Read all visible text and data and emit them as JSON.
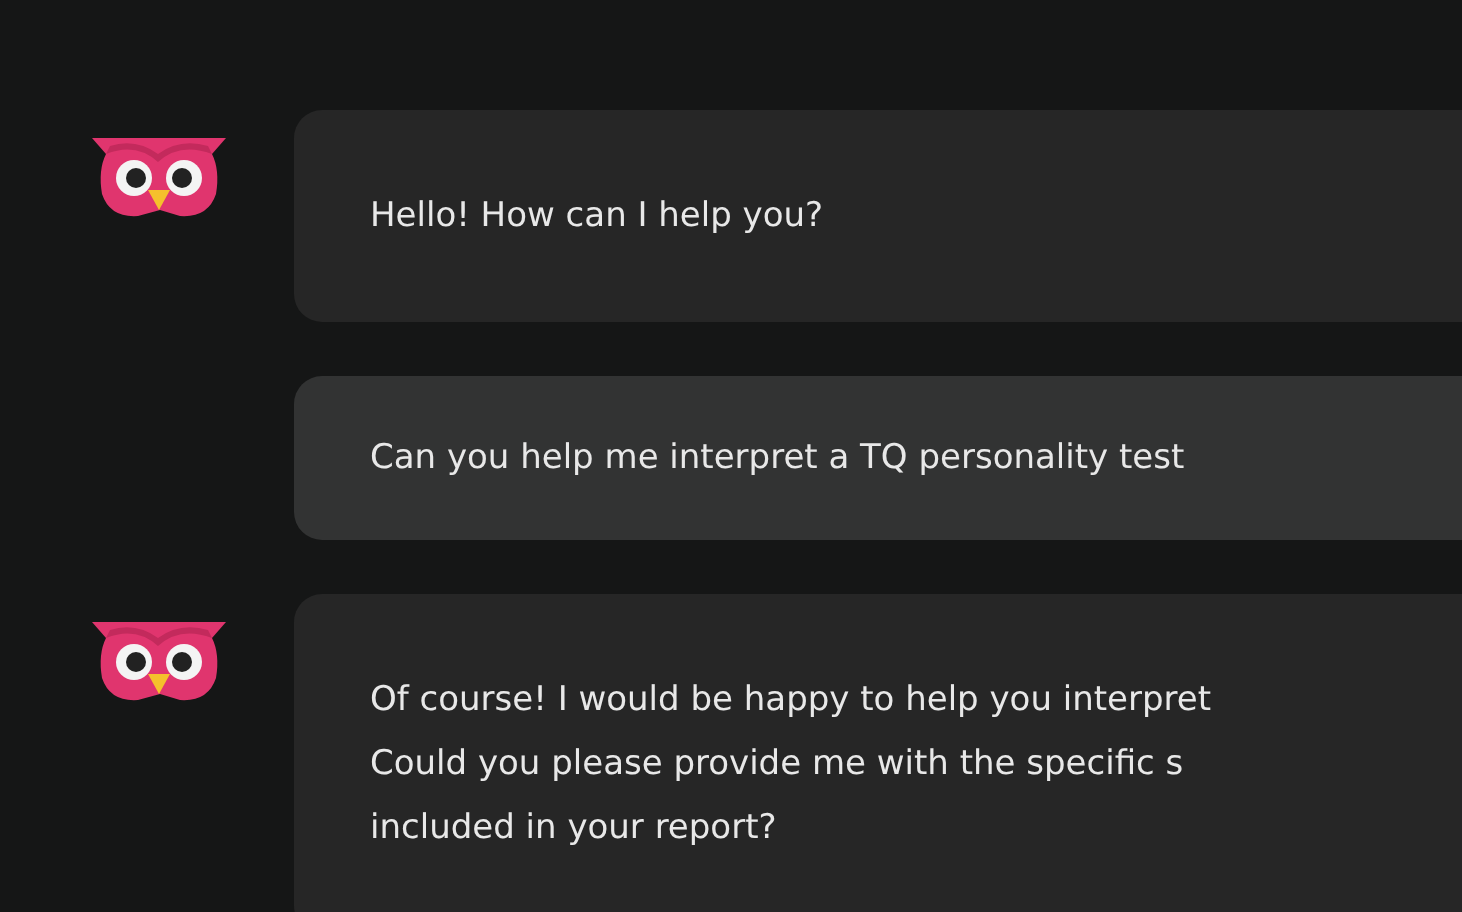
{
  "messages": [
    {
      "kind": "bot",
      "lines": [
        "Hello! How can I help you?"
      ]
    },
    {
      "kind": "user",
      "lines": [
        "Can you help me interpret a TQ personality test"
      ]
    },
    {
      "kind": "bot",
      "lines": [
        "Of course! I would be happy to help you interpret",
        "Could you please provide me with the specific s",
        "included in your report?"
      ]
    }
  ]
}
